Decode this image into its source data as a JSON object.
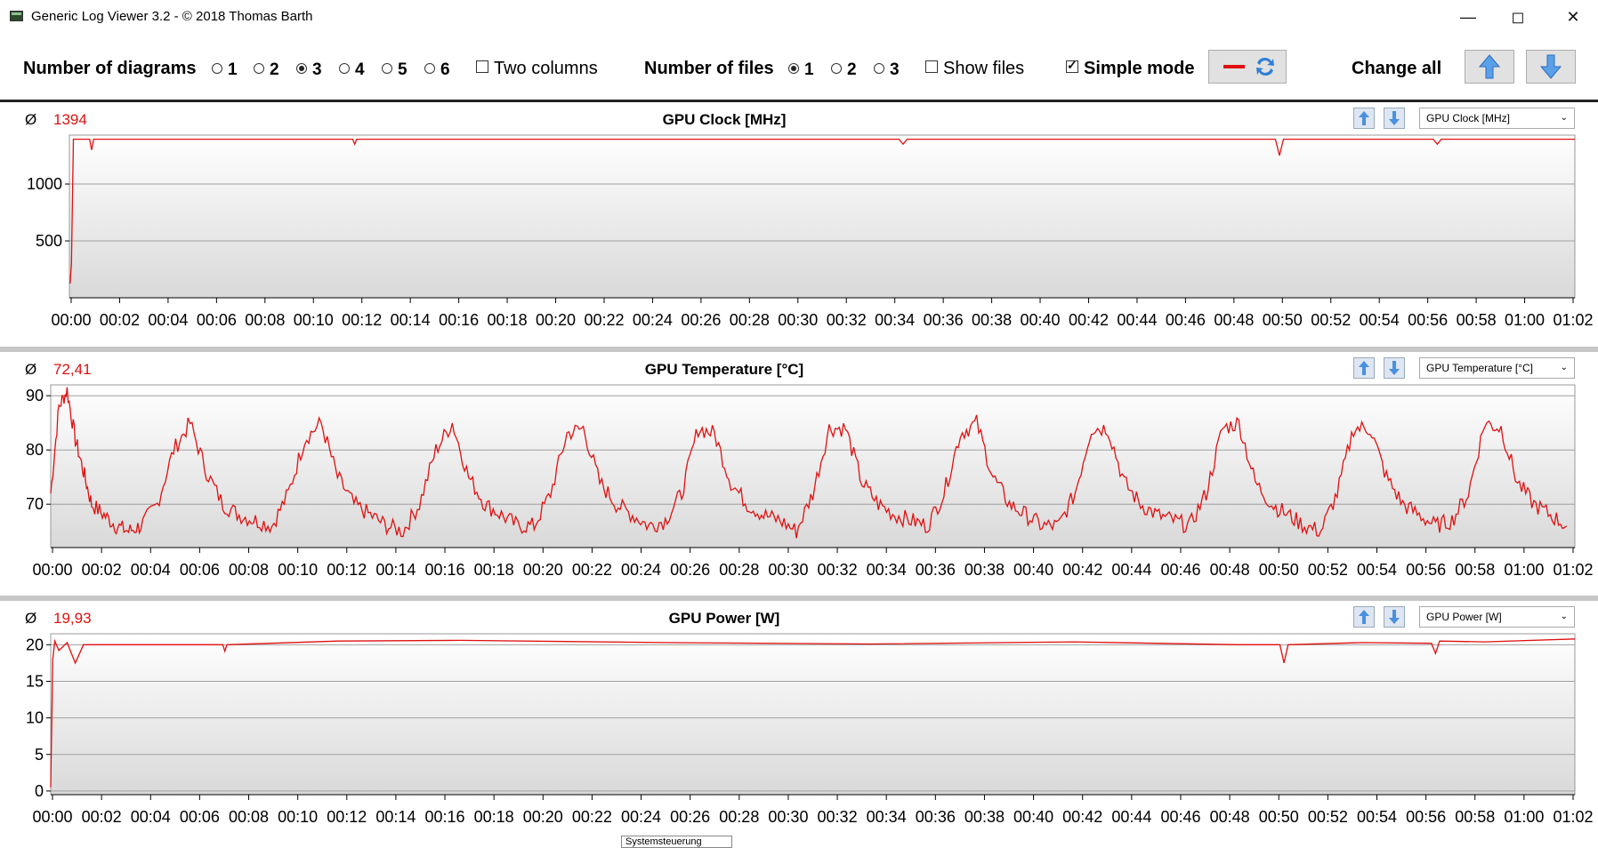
{
  "window": {
    "title": "Generic Log Viewer 3.2 - © 2018 Thomas Barth"
  },
  "toolbar": {
    "diagrams_label": "Number of diagrams",
    "diagram_options": [
      "1",
      "2",
      "3",
      "4",
      "5",
      "6"
    ],
    "diagram_selected": "3",
    "two_columns_label": "Two columns",
    "two_columns_checked": false,
    "files_label": "Number of files",
    "file_options": [
      "1",
      "2",
      "3"
    ],
    "file_selected": "1",
    "show_files_label": "Show files",
    "show_files_checked": false,
    "simple_mode_label": "Simple mode",
    "simple_mode_checked": true,
    "change_all_label": "Change all",
    "line_color": "#e01010",
    "arrow_color": "#3a7fd5"
  },
  "tooltip": {
    "text": "Systemsteuerung"
  },
  "panels": [
    {
      "title": "GPU Clock [MHz]",
      "average_symbol": "Ø",
      "average": "1394",
      "dropdown": "GPU Clock [MHz]",
      "chart_data": {
        "type": "line",
        "title": "GPU Clock [MHz]",
        "ylim": [
          0,
          1430
        ],
        "yticks": [
          "500",
          "1000"
        ],
        "ytick_values": [
          500,
          1000
        ],
        "grid": true,
        "xlim": [
          0,
          3720
        ],
        "xtick_labels": [
          "00:00",
          "00:02",
          "00:04",
          "00:06",
          "00:08",
          "00:10",
          "00:12",
          "00:14",
          "00:16",
          "00:18",
          "00:20",
          "00:22",
          "00:24",
          "00:26",
          "00:28",
          "00:30",
          "00:32",
          "00:34",
          "00:36",
          "00:38",
          "00:40",
          "00:42",
          "00:44",
          "00:46",
          "00:48",
          "00:50",
          "00:52",
          "00:54",
          "00:56",
          "00:58",
          "01:00",
          "01:02"
        ],
        "series": [
          {
            "x": [
              0,
              5,
              10,
              50,
              55,
              60,
              2,
              200,
              300,
              700,
              705,
              710,
              1000,
              1500,
              1900,
              2000,
              2050,
              2060,
              2070,
              2200,
              2500,
              2800,
              2980,
              2990,
              3000,
              3100,
              3370,
              3380,
              3390,
              3500,
              3720
            ],
            "y": [
              130,
              300,
              1394,
              1394,
              1300,
              1394,
              130,
              1394,
              1394,
              1394,
              1350,
              1394,
              1394,
              1394,
              1394,
              1394,
              1394,
              1350,
              1394,
              1394,
              1394,
              1394,
              1394,
              1250,
              1394,
              1394,
              1394,
              1350,
              1394,
              1394,
              1394
            ]
          }
        ]
      }
    },
    {
      "title": "GPU Temperature [°C]",
      "average_symbol": "Ø",
      "average": "72,41",
      "dropdown": "GPU Temperature [°C]",
      "chart_data": {
        "type": "line",
        "title": "GPU Temperature [°C]",
        "ylim": [
          62,
          92
        ],
        "yticks": [
          "70",
          "80",
          "90"
        ],
        "ytick_values": [
          70,
          80,
          90
        ],
        "grid": true,
        "xlim": [
          0,
          3720
        ],
        "xtick_labels": [
          "00:00",
          "00:02",
          "00:04",
          "00:06",
          "00:08",
          "00:10",
          "00:12",
          "00:14",
          "00:16",
          "00:18",
          "00:20",
          "00:22",
          "00:24",
          "00:26",
          "00:28",
          "00:30",
          "00:32",
          "00:34",
          "00:36",
          "00:38",
          "00:40",
          "00:42",
          "00:44",
          "00:46",
          "00:48",
          "00:50",
          "00:52",
          "00:54",
          "00:56",
          "00:58",
          "01:00",
          "01:02"
        ],
        "series": [
          {
            "x": [
              0,
              20,
              40,
              60,
              80,
              100,
              130,
              160,
              190,
              220,
              260,
              300,
              340,
              380,
              420,
              460,
              500,
              540,
              580,
              620,
              660,
              700,
              740,
              780,
              820,
              860,
              900,
              940,
              980,
              1020,
              1060,
              1100,
              1140,
              1180,
              1220,
              1260,
              1300,
              1340,
              1380,
              1420,
              1460,
              1500,
              1540,
              1580,
              1620,
              1660,
              1700,
              1740,
              1780,
              1820,
              1860,
              1900,
              1940,
              1980,
              2020,
              2060,
              2100,
              2140,
              2180,
              2220,
              2260,
              2300,
              2340,
              2380,
              2420,
              2460,
              2500,
              2540,
              2580,
              2620,
              2660,
              2700,
              2740,
              2780,
              2820,
              2860,
              2900,
              2940,
              2980,
              3020,
              3060,
              3100,
              3140,
              3180,
              3220,
              3260,
              3300,
              3340,
              3380,
              3420,
              3460,
              3500,
              3540,
              3580,
              3620,
              3660,
              3700
            ],
            "y": [
              72,
              88,
              91,
              82,
              76,
              70,
              68,
              66,
              65,
              66,
              70,
              80,
              85,
              76,
              70,
              68,
              67,
              66,
              72,
              82,
              85,
              75,
              70,
              68,
              66,
              65,
              70,
              80,
              85,
              75,
              70,
              68,
              66,
              66,
              72,
              83,
              84,
              74,
              70,
              68,
              66,
              67,
              72,
              84,
              83,
              74,
              70,
              68,
              67,
              65,
              72,
              84,
              84,
              74,
              70,
              68,
              67,
              66,
              72,
              83,
              85,
              75,
              70,
              68,
              66,
              66,
              72,
              84,
              84,
              74,
              70,
              68,
              67,
              66,
              72,
              84,
              85,
              74,
              70,
              68,
              66,
              65,
              72,
              84,
              84,
              75,
              70,
              68,
              66,
              67,
              72,
              85,
              84,
              74,
              70,
              68,
              66
            ],
            "_noise": true
          }
        ]
      }
    },
    {
      "title": "GPU Power [W]",
      "average_symbol": "Ø",
      "average": "19,93",
      "dropdown": "GPU Power [W]",
      "chart_data": {
        "type": "line",
        "title": "GPU Power [W]",
        "ylim": [
          -0.5,
          21.5
        ],
        "yticks": [
          "0",
          "5",
          "10",
          "15",
          "20"
        ],
        "ytick_values": [
          0,
          5,
          10,
          15,
          20
        ],
        "grid": true,
        "xlim": [
          0,
          3720
        ],
        "xtick_labels": [
          "00:00",
          "00:02",
          "00:04",
          "00:06",
          "00:08",
          "00:10",
          "00:12",
          "00:14",
          "00:16",
          "00:18",
          "00:20",
          "00:22",
          "00:24",
          "00:26",
          "00:28",
          "00:30",
          "00:32",
          "00:34",
          "00:36",
          "00:38",
          "00:40",
          "00:42",
          "00:44",
          "00:46",
          "00:48",
          "00:50",
          "00:52",
          "00:54",
          "00:56",
          "00:58",
          "01:00",
          "01:02"
        ],
        "series": [
          {
            "x": [
              0,
              5,
              10,
              20,
              40,
              60,
              80,
              300,
              420,
              425,
              430,
              700,
              1000,
              1500,
              2000,
              2500,
              2900,
              3000,
              3010,
              3020,
              3200,
              3370,
              3380,
              3390,
              3500,
              3720
            ],
            "y": [
              0.5,
              18,
              20.5,
              19.2,
              20.3,
              17.5,
              20,
              20,
              20,
              19.1,
              20,
              20.5,
              20.6,
              20.3,
              20.1,
              20.4,
              20,
              20,
              17.5,
              20,
              20.3,
              20.2,
              18.8,
              20.5,
              20.4,
              20.8
            ]
          }
        ]
      }
    }
  ]
}
